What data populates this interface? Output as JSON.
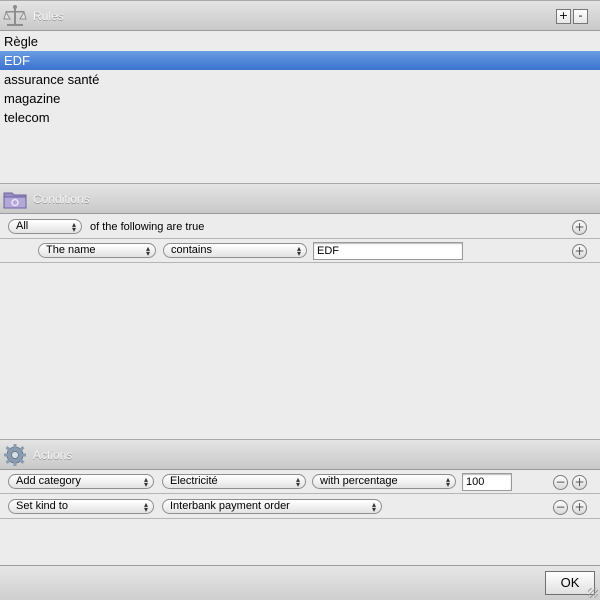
{
  "rules": {
    "header_title": "Rules",
    "add_label": "+",
    "remove_label": "-",
    "icon": "rules-scale-icon",
    "items": [
      {
        "label": "Règle",
        "selected": false
      },
      {
        "label": "EDF",
        "selected": true
      },
      {
        "label": "assurance santé",
        "selected": false
      },
      {
        "label": "magazine",
        "selected": false
      },
      {
        "label": "telecom",
        "selected": false
      }
    ]
  },
  "conditions": {
    "header_title": "Conditions",
    "icon": "conditions-folder-icon",
    "match_mode": "All",
    "match_text": "of the following are true",
    "add_label": "+",
    "criteria": [
      {
        "field": "The name",
        "operator": "contains",
        "value": "EDF",
        "add_label": "+"
      }
    ]
  },
  "actions": {
    "header_title": "Actions",
    "icon": "actions-gear-icon",
    "rows": [
      {
        "action": "Add category",
        "target": "Electricité",
        "modifier": "with percentage",
        "value": "100",
        "remove_label": "−",
        "add_label": "+"
      },
      {
        "action": "Set kind to",
        "target": "Interbank payment order",
        "remove_label": "−",
        "add_label": "+"
      }
    ]
  },
  "footer": {
    "ok_label": "OK"
  },
  "colors": {
    "selection": "#3b72cf",
    "header_bg": "#d6d6d6",
    "panel_bg": "#ececec"
  }
}
